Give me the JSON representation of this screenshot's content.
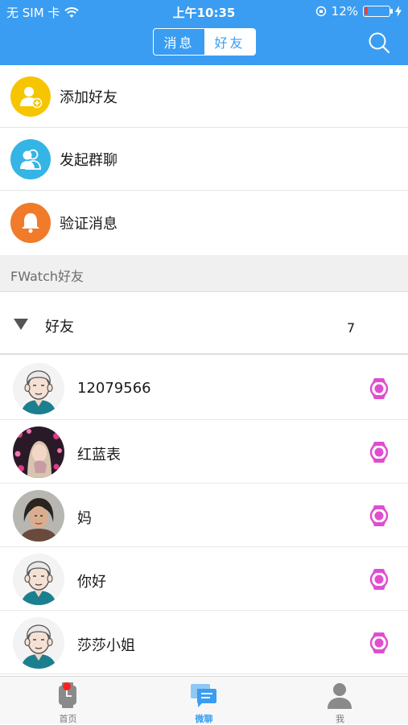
{
  "status_bar": {
    "carrier": "无 SIM 卡",
    "time": "上午10:35",
    "battery_text": "12%",
    "battery_level": 0.12
  },
  "header": {
    "tabs": [
      {
        "label": "消息",
        "active": false
      },
      {
        "label": "好友",
        "active": true
      }
    ],
    "search_icon": "search-icon"
  },
  "menu": [
    {
      "label": "添加好友",
      "icon": "add-friend-icon",
      "color": "#f7c500"
    },
    {
      "label": "发起群聊",
      "icon": "group-chat-icon",
      "color": "#35b4e6"
    },
    {
      "label": "验证消息",
      "icon": "bell-icon",
      "color": "#f07b2a"
    }
  ],
  "section": {
    "title": "FWatch好友"
  },
  "group": {
    "label": "好友",
    "count": "7",
    "expanded": true
  },
  "friends": [
    {
      "name": "12079566",
      "avatar": "elder-avatar"
    },
    {
      "name": "红蓝表",
      "avatar": "photo-avatar"
    },
    {
      "name": "妈",
      "avatar": "photo-avatar"
    },
    {
      "name": "你好",
      "avatar": "elder-avatar"
    },
    {
      "name": "莎莎小姐",
      "avatar": "elder-avatar"
    }
  ],
  "tabbar": {
    "tabs": [
      {
        "label": "首页",
        "icon": "watch-home-icon",
        "active": false,
        "badge": true
      },
      {
        "label": "微聊",
        "icon": "chat-icon",
        "active": true,
        "badge": false
      },
      {
        "label": "我",
        "icon": "person-icon",
        "active": false,
        "badge": false
      }
    ]
  },
  "colors": {
    "primary": "#3a9df1",
    "watch_icon": "#e04ed0",
    "badge": "#ff1f1f"
  }
}
